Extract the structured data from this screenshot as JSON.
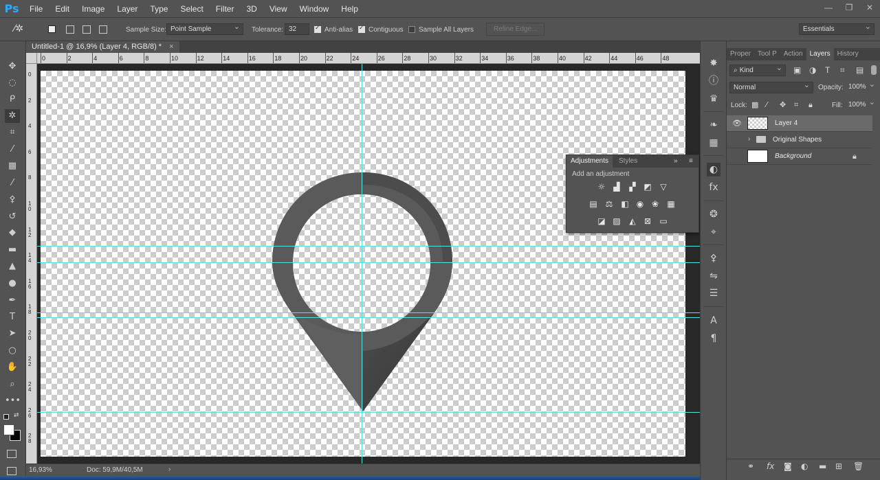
{
  "app": {
    "logo": "Ps"
  },
  "menu": [
    "File",
    "Edit",
    "Image",
    "Layer",
    "Type",
    "Select",
    "Filter",
    "3D",
    "View",
    "Window",
    "Help"
  ],
  "window_controls": {
    "minimize": "—",
    "restore": "❐",
    "close": "✕"
  },
  "options": {
    "sample_size_label": "Sample Size:",
    "sample_size_value": "Point Sample",
    "tolerance_label": "Tolerance:",
    "tolerance_value": "32",
    "anti_alias_label": "Anti-alias",
    "anti_alias_checked": true,
    "contiguous_label": "Contiguous",
    "contiguous_checked": true,
    "sample_all_layers_label": "Sample All Layers",
    "sample_all_layers_checked": false,
    "refine_edge_label": "Refine Edge...",
    "workspace": "Essentials"
  },
  "document": {
    "tab_title": "Untitled-1 @ 16,9% (Layer 4, RGB/8) *",
    "close": "×",
    "zoom": "16,93%",
    "doc_size": "Doc: 59,9M/40,5M"
  },
  "ruler": {
    "h_labels": [
      "0",
      "2",
      "4",
      "6",
      "8",
      "10",
      "12",
      "14",
      "16",
      "18",
      "20",
      "22",
      "24",
      "26",
      "28",
      "30",
      "32",
      "34",
      "36",
      "38",
      "40",
      "42",
      "44",
      "46",
      "48"
    ],
    "v_labels": [
      "0",
      "2",
      "4",
      "6",
      "8",
      "10",
      "12",
      "14",
      "16",
      "18",
      "20",
      "22",
      "24",
      "26",
      "28"
    ]
  },
  "panel_tabs": [
    "Proper",
    "Tool P",
    "Action",
    "Layers",
    "History"
  ],
  "layers": {
    "filter_kind": "Kind",
    "blend_mode": "Normal",
    "opacity_label": "Opacity:",
    "opacity_value": "100%",
    "lock_label": "Lock:",
    "fill_label": "Fill:",
    "fill_value": "100%",
    "items": [
      {
        "name": "Layer 4",
        "visible": true,
        "selected": true
      },
      {
        "name": "Original Shapes",
        "visible": false,
        "selected": false
      },
      {
        "name": "Background",
        "visible": false,
        "selected": false
      }
    ]
  },
  "adjustments": {
    "tab1": "Adjustments",
    "tab2": "Styles",
    "heading": "Add an adjustment",
    "expand": "»",
    "menu": "≡"
  },
  "colors": {
    "accent": "#31a8ff",
    "guide": "#4fe3e3",
    "pin": "#555555"
  }
}
